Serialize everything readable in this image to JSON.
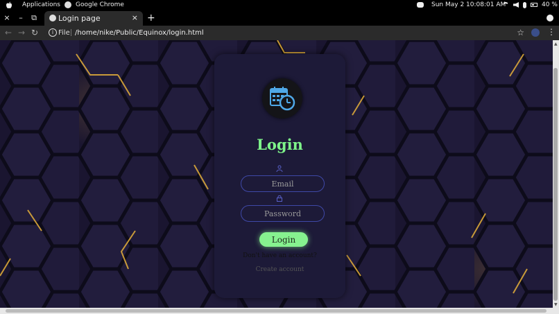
{
  "system_bar": {
    "apps_label": "Applications",
    "chrome_label": "Google Chrome",
    "datetime": "Sun May 2  10:08:01 AM",
    "battery": "40 %"
  },
  "browser": {
    "tab_title": "Login page",
    "tab_close": "×",
    "new_tab": "+",
    "window_close": "×",
    "window_min": "–",
    "window_restore": "⧉",
    "file_label": "File",
    "url": "/home/nike/Public/Equinox/login.html"
  },
  "login": {
    "heading": "Login",
    "email_placeholder": "Email",
    "password_placeholder": "Password",
    "button_label": "Login",
    "no_account_text": "Don't have an account?",
    "create_account_label": "Create account"
  },
  "colors": {
    "accent_green": "#86f28f",
    "input_border": "#3f49a8",
    "card_bg": "#1d1a38",
    "hex_glow": "#ffbe3c"
  },
  "icons": [
    "apple-icon",
    "chrome-icon",
    "discord-icon",
    "wifi-icon",
    "volume-icon",
    "mic-icon",
    "battery-icon",
    "back-icon",
    "forward-icon",
    "reload-icon",
    "info-icon",
    "star-icon",
    "menu-icon",
    "calendar-clock-icon",
    "user-icon",
    "lock-icon"
  ]
}
